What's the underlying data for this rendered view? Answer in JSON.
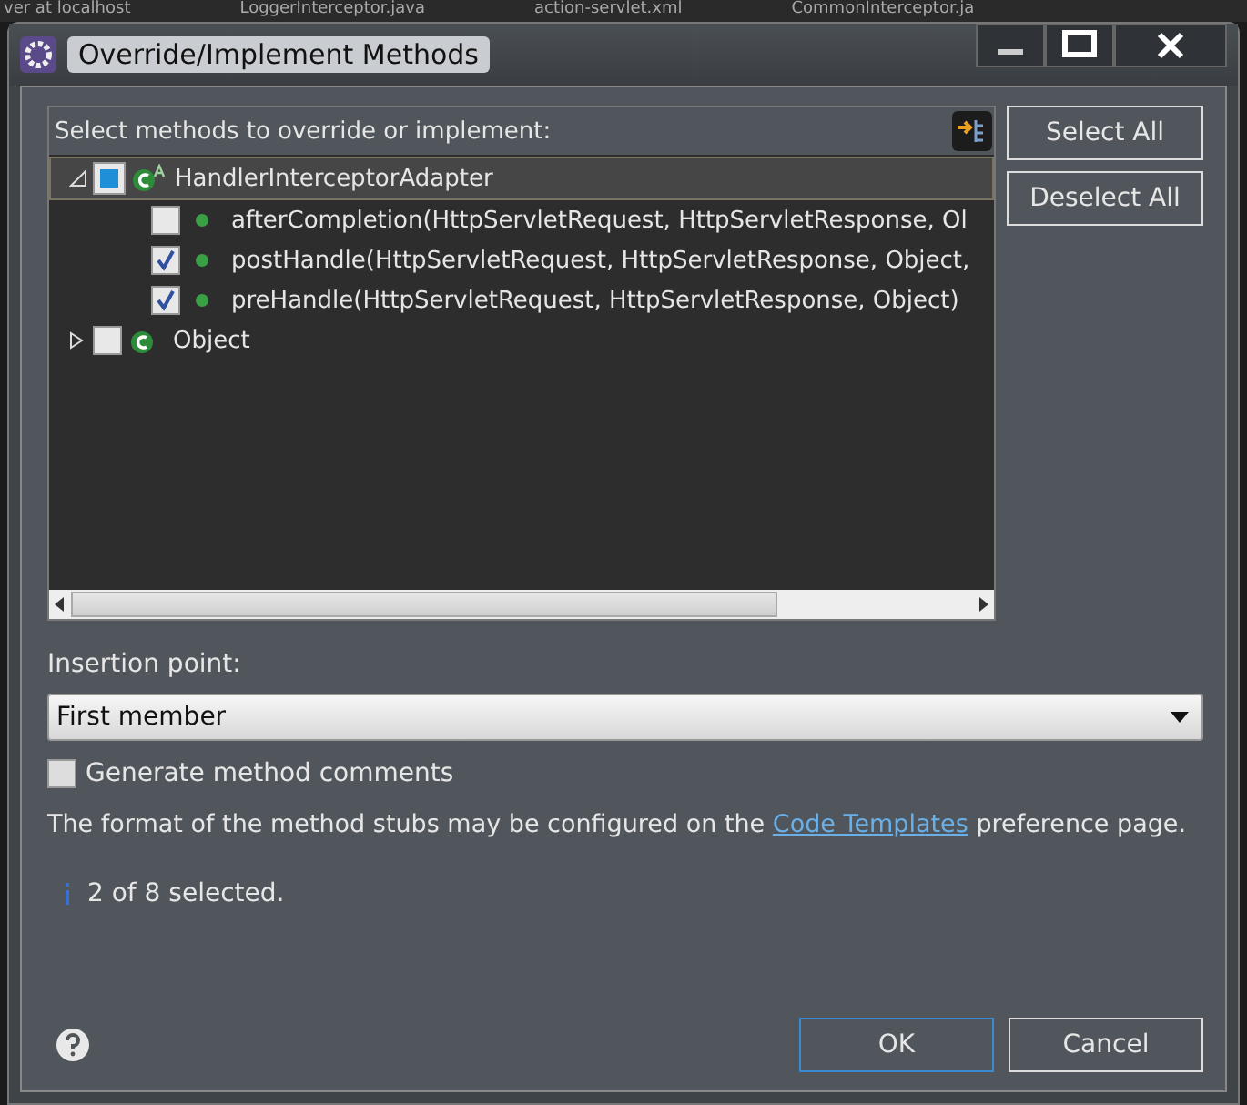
{
  "background_tabs": [
    "ver at localhost",
    "LoggerInterceptor.java",
    "action-servlet.xml",
    "CommonInterceptor.ja"
  ],
  "window": {
    "title": "Override/Implement Methods"
  },
  "tree_label": "Select methods to override or implement:",
  "tree": [
    {
      "kind": "class",
      "label": "HandlerInterceptorAdapter",
      "abstract": true,
      "expanded": true,
      "checked": true,
      "grayed": true,
      "selected": true,
      "children": [
        {
          "kind": "method",
          "label": "afterCompletion(HttpServletRequest, HttpServletResponse, Ol",
          "checked": false,
          "selected": false
        },
        {
          "kind": "method",
          "label": "postHandle(HttpServletRequest, HttpServletResponse, Object,",
          "checked": true,
          "selected": false
        },
        {
          "kind": "method",
          "label": "preHandle(HttpServletRequest, HttpServletResponse, Object)",
          "checked": true,
          "selected": false
        }
      ]
    },
    {
      "kind": "class",
      "label": "Object",
      "abstract": false,
      "expanded": false,
      "checked": false,
      "selected": false
    }
  ],
  "side_buttons": [
    "Select All",
    "Deselect All"
  ],
  "insertion_label": "Insertion point:",
  "insertion_value": "First member",
  "generate_comments": {
    "label": "Generate method comments",
    "checked": false
  },
  "info": {
    "before": "The format of the method stubs may be configured on the ",
    "link": "Code Templates",
    "after": " preference page."
  },
  "status": "2 of 8 selected.",
  "buttons": [
    "OK",
    "Cancel"
  ]
}
